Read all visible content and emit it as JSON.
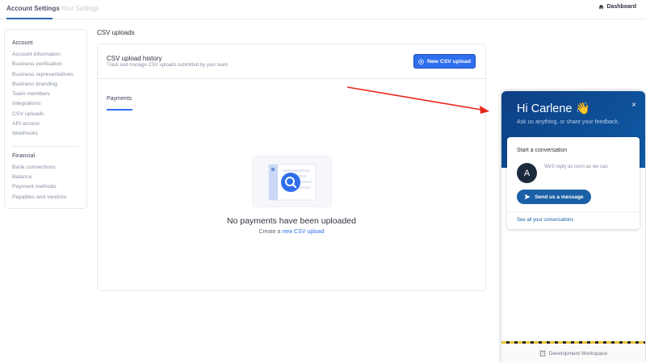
{
  "topbar": {
    "tabs": [
      {
        "label": "Account Settings",
        "active": true
      },
      {
        "label": "Your Settings",
        "active": false
      }
    ],
    "dashboard_label": "Dashboard",
    "dashboard_icon": "home-icon"
  },
  "sidebar": {
    "account_heading": "Account",
    "account_items": [
      "Account information",
      "Business verification",
      "Business representatives",
      "Business branding",
      "Team members",
      "Integrations",
      "CSV uploads",
      "API access",
      "Webhooks"
    ],
    "financial_heading": "Financial",
    "financial_items": [
      "Bank connections",
      "Balance",
      "Payment methods",
      "Payables and vendors"
    ]
  },
  "main": {
    "page_title": "CSV uploads",
    "card_title": "CSV upload history",
    "card_subtitle": "Track and manage CSV uploads submitted by your team",
    "new_button_label": "New CSV upload",
    "new_button_icon": "plus-circle-icon",
    "tab_label": "Payments",
    "empty_title": "No payments have been uploaded",
    "empty_sub_prefix": "Create a ",
    "empty_sub_link": "new CSV upload",
    "illustration_icon": "search-document-icon"
  },
  "chat": {
    "greeting": "Hi Carlene 👋",
    "subtitle": "Ask us anything, or share your feedback.",
    "close_label": "×",
    "convo_title": "Start a conversation",
    "avatar_initial": "A",
    "reply_note": "We'll reply as soon as we can",
    "send_label": "Send us a message",
    "send_icon": "send-icon",
    "see_all_label": "See all your conversations",
    "dev_label": "Development Workspace",
    "dev_icon": "building-icon"
  },
  "colors": {
    "accent": "#2f6fed",
    "chat_header": "#0d3f84",
    "annotation_arrow": "#e8261b"
  }
}
